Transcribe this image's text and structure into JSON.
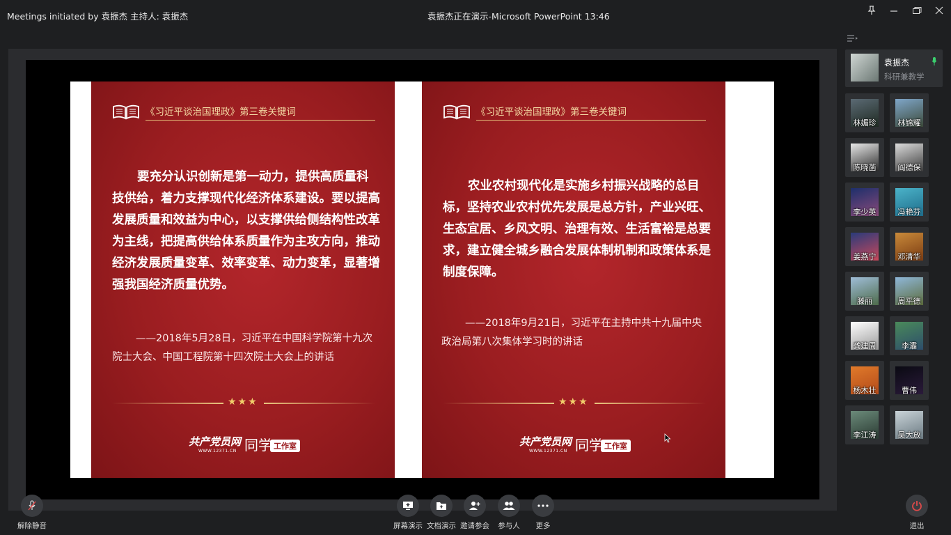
{
  "titlebar": {
    "meeting_title": "Meetings initiated by 袁振杰    主持人: 袁振杰",
    "window_title": "袁振杰正在演示-Microsoft PowerPoint 13:46"
  },
  "slide": {
    "left": {
      "header": "《习近平谈治国理政》第三卷关键词",
      "body": "要充分认识创新是第一动力，提供高质量科技供给，着力支撑现代化经济体系建设。要以提高发展质量和效益为中心，以支撑供给侧结构性改革为主线，把提高供给体系质量作为主攻方向，推动经济发展质量变革、效率变革、动力变革，显著增强我国经济质量优势。",
      "quote": "——2018年5月28日，习近平在中国科学院第十九次院士大会、中国工程院第十四次院士大会上的讲话",
      "stars": "★★★",
      "logo_calligraphy": "共产党员网",
      "logo_url": "WWW.12371.CN",
      "logo_text": "同学",
      "logo_badge": "工作室"
    },
    "right": {
      "header": "《习近平谈治国理政》第三卷关键词",
      "body": "农业农村现代化是实施乡村振兴战略的总目标，坚持农业农村优先发展是总方针，产业兴旺、生态宜居、乡风文明、治理有效、生活富裕是总要求，建立健全城乡融合发展体制机制和政策体系是制度保障。",
      "quote": "——2018年9月21日，习近平在主持中共十九届中央政治局第八次集体学习时的讲话",
      "stars": "★★★",
      "logo_calligraphy": "共产党员网",
      "logo_url": "WWW.12371.CN",
      "logo_text": "同学",
      "logo_badge": "工作室"
    }
  },
  "host": {
    "name": "袁振杰",
    "role": "科研兼教学"
  },
  "participants": [
    {
      "name": "林媚珍",
      "c1": "#5b6a74",
      "c2": "#1f2a22"
    },
    {
      "name": "林锦耀",
      "c1": "#7fa6c9",
      "c2": "#3c4a3a"
    },
    {
      "name": "陈晓菡",
      "c1": "#e8e8e8",
      "c2": "#2a2a2a"
    },
    {
      "name": "阎德保",
      "c1": "#dcdcdc",
      "c2": "#3b3b3b"
    },
    {
      "name": "李少英",
      "c1": "#1d2f6b",
      "c2": "#8a4a7a"
    },
    {
      "name": "冯艳芬",
      "c1": "#4bb3c9",
      "c2": "#1e6c8a"
    },
    {
      "name": "姜燕宁",
      "c1": "#2a3b7a",
      "c2": "#c9485a"
    },
    {
      "name": "邓清华",
      "c1": "#c98a3a",
      "c2": "#7a3b12"
    },
    {
      "name": "滕丽",
      "c1": "#9fbdd8",
      "c2": "#4d6b4a"
    },
    {
      "name": "周平德",
      "c1": "#8fb7d9",
      "c2": "#5b6b3b"
    },
    {
      "name": "龚建周",
      "c1": "#ffffff",
      "c2": "#9a9a9a"
    },
    {
      "name": "李灞",
      "c1": "#4a8a5a",
      "c2": "#2d4d6b"
    },
    {
      "name": "杨木壮",
      "c1": "#e07a2a",
      "c2": "#b34a1a"
    },
    {
      "name": "曹伟",
      "c1": "#0a0a12",
      "c2": "#2a1a3a"
    },
    {
      "name": "李江涛",
      "c1": "#6b8a7a",
      "c2": "#2a3a32"
    },
    {
      "name": "吴大放",
      "c1": "#c9d3d8",
      "c2": "#6b7a82"
    }
  ],
  "controls": {
    "unmute": "解除静音",
    "screen_share": "屏幕演示",
    "doc_share": "文档演示",
    "invite": "邀请参会",
    "participants": "参与人",
    "more": "更多",
    "leave": "退出"
  },
  "colors": {
    "slide_red": "#9a1d20",
    "gold": "#e8c57e",
    "leave_red": "#e04a4a",
    "mic_green": "#3bd16f"
  }
}
